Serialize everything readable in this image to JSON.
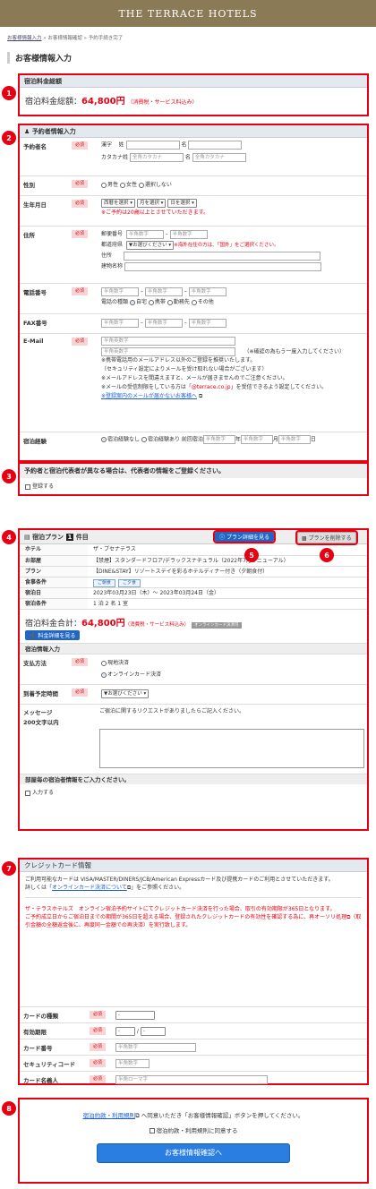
{
  "header": {
    "title": "THE TERRACE HOTELS"
  },
  "breadcrumb": {
    "step1": "お客様情報入力",
    "sep": "»",
    "step2": "お客様情報確認",
    "step3": "予約手続き完了"
  },
  "page_title": "お客様情報入力",
  "markers": [
    "1",
    "2",
    "3",
    "4",
    "5",
    "6",
    "7",
    "8"
  ],
  "total": {
    "head": "宿泊料金総額",
    "label": "宿泊料金総額：",
    "amount": "64,800円",
    "note": "（消費税・サービス料込み）"
  },
  "req_label": "必須",
  "booker": {
    "head": "予約者情報入力",
    "name": {
      "label": "予約者名",
      "kanji": "漢字",
      "sei": "姓",
      "mei": "名",
      "kana": "カタカナ姓",
      "kana_mei": "名",
      "ph_kana_sei": "全角カタカナ",
      "ph_kana_mei": "全角カタカナ"
    },
    "gender": {
      "label": "性別",
      "options": [
        "男性",
        "女性",
        "選択しない"
      ]
    },
    "birth": {
      "label": "生年月日",
      "year": "西暦を選択 ▾",
      "month": "月を選択 ▾",
      "day": "日を選択 ▾",
      "note": "※ご予約は20歳以上とさせていただきます。"
    },
    "address": {
      "label": "住所",
      "zip": "郵便番号",
      "ph_num": "半角数字",
      "pref": "都道府県",
      "pref_sel": "▼お選びください ▾",
      "pref_note": "※海外在住の方は、「国外」をご選択ください。",
      "addr": "住所",
      "bldg": "建物名称"
    },
    "phone": {
      "label": "電話番号",
      "ph": "半角数字",
      "type_label": "電話の種類",
      "types": [
        "自宅",
        "携帯",
        "勤務先",
        "その他"
      ]
    },
    "fax": {
      "label": "FAX番号",
      "ph": "半角数字"
    },
    "email": {
      "label": "E-Mail",
      "ph": "半角英数字",
      "confirm_note": "（※確認の為もう一度入力してください）",
      "n1": "※携帯電話用のメールアドレス以外のご登録を推奨いたします。",
      "n1b": "（セキュリティ設定によりメールを受け取れない場合がございます）",
      "n2": "※メールアドレスを間違えますと、メールが届きませんのでご注意ください。",
      "n3a": "※メールの受信制限をしている方は「",
      "n3domain": "@terrace.co.jp",
      "n3b": "」を受信できるよう設定してください。",
      "n4": "※登録案内のメールが届かないお客様へ"
    },
    "stay": {
      "label": "宿泊経験",
      "none": "宿泊経験なし",
      "yes": "宿泊経験あり",
      "prev": "前回宿泊",
      "ph": "半角数字",
      "y": "年",
      "m": "月",
      "d": "日"
    }
  },
  "rep": {
    "text": "予約者と宿泊代表者が異なる場合は、代表者の情報をご登録ください。",
    "check": "登録する"
  },
  "plan": {
    "head": "宿泊プラン",
    "count": "1",
    "count_suffix": "件目",
    "detail_btn": "プラン詳細を見る",
    "delete_btn": "プランを削除する",
    "rows": [
      {
        "label": "ホテル",
        "value": "ザ・ブセナテラス"
      },
      {
        "label": "お部屋",
        "value": "【禁煙】スタンダードフロア/デラックスナチュラル（2022年7月リニューアル）"
      },
      {
        "label": "プラン",
        "value": "【DINE&STAY】リゾートステイを彩るホテルディナー付き（夕朝食付）"
      },
      {
        "label": "食事条件",
        "tags": [
          "ご朝食",
          "ご夕食"
        ]
      },
      {
        "label": "宿泊日",
        "value": "2023年03月23日（木）〜 2023年03月24日（金）"
      },
      {
        "label": "宿泊条件",
        "value": "1 泊 2 名 1 室"
      }
    ],
    "total_label": "宿泊料金合計：",
    "total_amount": "64,800円",
    "total_note": "（消費税・サービス料込み）",
    "card_badge": "オンラインカード決済可",
    "fee_btn": "料金詳細を見る",
    "info_head": "宿泊情報入力",
    "pay": {
      "label": "支払方法",
      "options": [
        "現地決済",
        "オンラインカード決済"
      ]
    },
    "arrival": {
      "label": "到着予定時間",
      "value": "▼お選びください ▾"
    },
    "msg": {
      "label": "メッセージ",
      "sub": "200文字以内",
      "text": "ご宿泊に関するリクエストがありましたらご記入ください。"
    },
    "room_head": "部屋毎の宿泊者情報をご入力ください。",
    "room_check": "入力する"
  },
  "card": {
    "head": "クレジットカード情報",
    "p1": "ご利用可能なカードは VISA/MASTER/DINERS/JCB/American Expressカード及び提携カードのご利用とさせていただきます。",
    "p2a": "詳しくは「",
    "p2link": "オンラインカード決済について",
    "p2b": "」をご参照ください。",
    "r1": "ザ・テラスホテルズ　オンライン宿泊予約サイトにてクレジットカード決済を行った場合、取引の有効期限が365日となります。",
    "r2a": "ご予約成立日からご宿泊日までの期間が365日を超える場合、登録されたクレジットカードの有効性を確認する為に、再オーソリ処理",
    "r2b": "（取引金額の全額返金後に、再度同一金額での再決済）を実行致します。",
    "type": {
      "label": "カードの種類",
      "value": "-"
    },
    "exp": {
      "label": "有効期限",
      "m": "-",
      "slash": "/",
      "y": "-"
    },
    "number": {
      "label": "カード番号",
      "ph": "半角数字"
    },
    "cvc": {
      "label": "セキュリティコード",
      "ph": "半角数字"
    },
    "holder": {
      "label": "カード名義人",
      "ph": "半角ローマ字"
    }
  },
  "agree": {
    "link": "宿泊約款・利用規則",
    "text": "へ同意いただき「お客様情報確認」ボタンを押してください。",
    "check": "宿泊約款・利用規則に同意する",
    "button": "お客様情報確認へ"
  }
}
